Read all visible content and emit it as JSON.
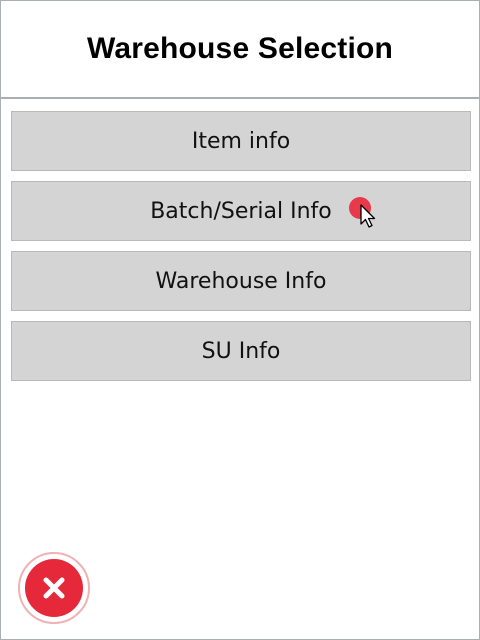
{
  "header": {
    "title": "Warehouse Selection"
  },
  "menu": {
    "items": [
      {
        "label": "Item info"
      },
      {
        "label": "Batch/Serial Info"
      },
      {
        "label": "Warehouse Info"
      },
      {
        "label": "SU Info"
      }
    ]
  },
  "footer": {
    "close_icon": "close-icon",
    "close_color": "#e5283a"
  },
  "cursor": {
    "icon": "pointer-cursor-icon",
    "indicator_color": "#e8394b"
  }
}
